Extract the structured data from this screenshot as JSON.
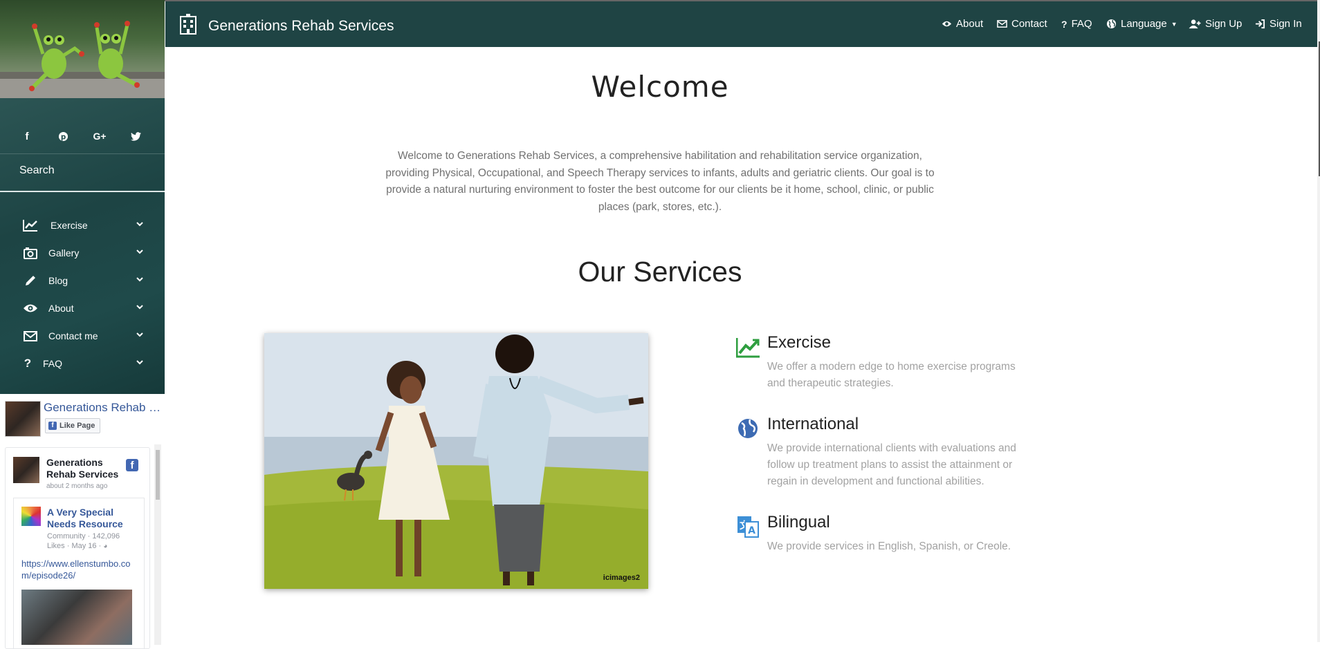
{
  "sidebar": {
    "social": [
      "facebook-icon",
      "pinterest-icon",
      "google-plus-icon",
      "twitter-icon"
    ],
    "search_label": "Search",
    "nav": [
      {
        "label": "Exercise",
        "icon": "chart-line-icon"
      },
      {
        "label": "Gallery",
        "icon": "camera-icon"
      },
      {
        "label": "Blog",
        "icon": "pencil-icon"
      },
      {
        "label": "About",
        "icon": "eye-icon"
      },
      {
        "label": "Contact me",
        "icon": "envelope-icon"
      },
      {
        "label": "FAQ",
        "icon": "question-icon"
      }
    ],
    "facebook": {
      "page_name": "Generations Rehab Services",
      "like_label": "Like Page",
      "post_author": "Generations Rehab Services",
      "post_time": "about 2 months ago",
      "share_title": "A Very Special Needs Resource",
      "share_meta": "Community · 142,096 Likes · May 16 ·",
      "share_link": "https://www.ellenstumbo.com/episode26/"
    }
  },
  "topbar": {
    "brand": "Generations Rehab Services",
    "links": [
      {
        "label": "About",
        "icon": "eye-icon"
      },
      {
        "label": "Contact",
        "icon": "envelope-icon"
      },
      {
        "label": "FAQ",
        "icon": "question-icon"
      },
      {
        "label": "Language",
        "icon": "globe-icon"
      },
      {
        "label": "Sign Up",
        "icon": "user-plus-icon"
      },
      {
        "label": "Sign In",
        "icon": "sign-in-icon"
      }
    ]
  },
  "main": {
    "welcome_title": "Welcome",
    "intro": "Welcome to Generations Rehab Services, a comprehensive habilitation and rehabilitation service organization, providing Physical, Occupational, and Speech Therapy services to infants, adults and geriatric clients. Our goal is to provide a natural nurturing environment to foster the best outcome for our clients be it home, school, clinic, or public places (park, stores, etc.).",
    "services_title": "Our Services",
    "hero_caption": "icimages2",
    "services": [
      {
        "title": "Exercise",
        "desc": "We offer a modern edge to home exercise programs and therapeutic strategies.",
        "icon": "chart-line-icon"
      },
      {
        "title": "International",
        "desc": "We provide international clients with evaluations and follow up treatment plans to assist the attainment or regain in development and functional abilities.",
        "icon": "globe-icon"
      },
      {
        "title": "Bilingual",
        "desc": "We provide services in English, Spanish, or Creole.",
        "icon": "translate-icon"
      }
    ]
  },
  "colors": {
    "sidebar": "#1f4a4a",
    "topbar": "#1f4444",
    "accent_green": "#2e9e3f",
    "icon_blue": "#3d6bb3",
    "link_blue": "#365899"
  }
}
